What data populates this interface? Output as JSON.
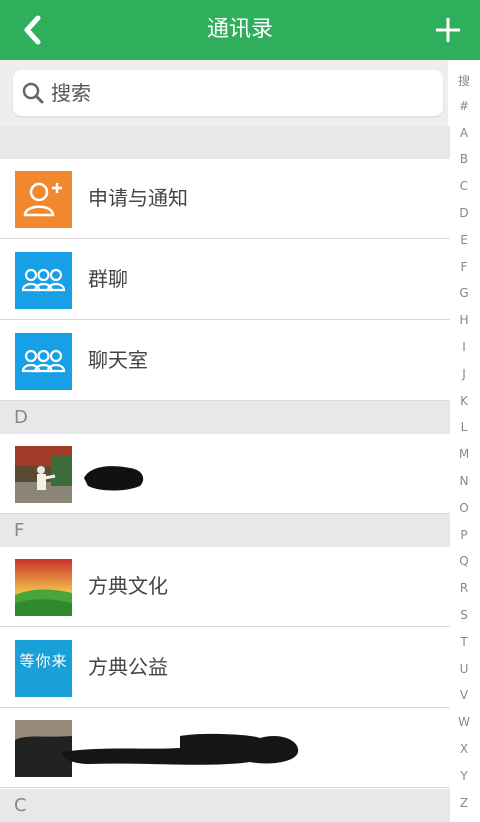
{
  "header": {
    "title": "通讯录",
    "back_icon": "chevron-left-icon",
    "add_icon": "plus-icon",
    "color": "#2fae5b"
  },
  "search": {
    "placeholder": "搜索",
    "icon": "search-icon"
  },
  "special_items": [
    {
      "label": "申请与通知",
      "icon": "add-user-icon",
      "color": "#f0892e"
    },
    {
      "label": "群聊",
      "icon": "group-icon",
      "color": "#17a0e6"
    },
    {
      "label": "聊天室",
      "icon": "group-icon",
      "color": "#17a0e6"
    }
  ],
  "sections": [
    {
      "letter": "D"
    },
    {
      "letter": "F"
    },
    {
      "letter": "C"
    }
  ],
  "contacts": [
    {
      "label": "",
      "note": "name redacted"
    },
    {
      "label": "方典文化"
    },
    {
      "label": "方典公益",
      "avatar_text": "等你来"
    },
    {
      "label": "",
      "note": "name redacted"
    }
  ],
  "index_letters": [
    "搜",
    "#",
    "A",
    "B",
    "C",
    "D",
    "E",
    "F",
    "G",
    "H",
    "I",
    "J",
    "K",
    "L",
    "M",
    "N",
    "O",
    "P",
    "Q",
    "R",
    "S",
    "T",
    "U",
    "V",
    "W",
    "X",
    "Y",
    "Z"
  ]
}
